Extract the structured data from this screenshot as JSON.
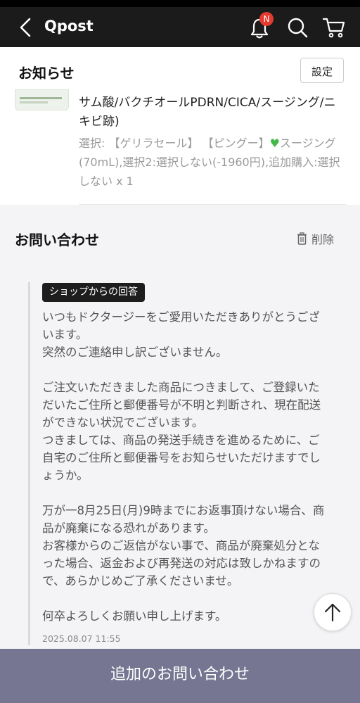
{
  "app": {
    "title": "Qpost",
    "notification_badge": "N"
  },
  "header": {
    "title": "お知らせ",
    "settings_label": "設定"
  },
  "product": {
    "name": "サム酸/バクチオールPDRN/CICA/スージング/ニキビ跡)",
    "options_prefix": "選択: 【ゲリラセール】 【ピングー】",
    "options_suffix": "スージング(70mL),選択2:選択しない(-1960円),追加購入:選択しない x 1"
  },
  "inquiry": {
    "title": "お問い合わせ",
    "delete_label": "削除",
    "shop_reply_tag": "ショップからの回答",
    "reply_text": "いつもドクタージーをご愛用いただきありがとうございます。\n突然のご連絡申し訳ございません。\n\nご注文いただきました商品につきまして、ご登録いただいたご住所と郵便番号が不明と判断され、現在配送ができない状況でございます。\nつきましては、商品の発送手続きを進めるために、ご自宅のご住所と郵便番号をお知らせいただけますでしょうか。\n\n万が一8月25日(月)9時までにお返事頂けない場合、商品が廃棄になる恐れがあります。\nお客様からのご返信がない事で、商品が廃棄処分となった場合、返金および再発送の対応は致しかねますので、あらかじめご了承くださいませ。\n\n何卒よろしくお願い申し上げます。",
    "reply_date": "2025.08.07 11:55"
  },
  "footer": {
    "add_inquiry_label": "追加のお問い合わせ"
  },
  "colors": {
    "topbar": "#1b1b1b",
    "badge": "#e53a2f",
    "footer_button": "#767692",
    "heart": "#43b94a"
  }
}
